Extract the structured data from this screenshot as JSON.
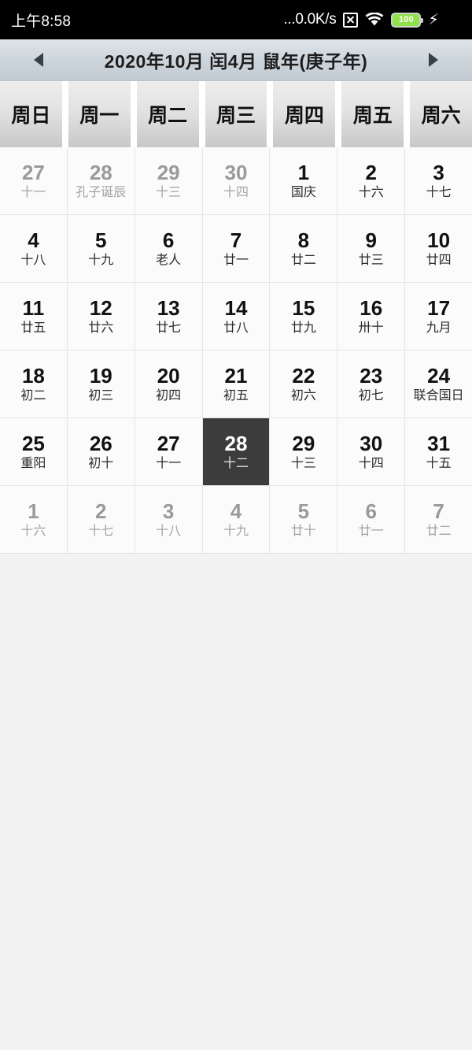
{
  "statusbar": {
    "time": "上午8:58",
    "net_speed": "...0.0K/s",
    "nosim_icon": "no-sim-icon",
    "wifi_icon": "wifi-icon",
    "battery_level": "100",
    "charging_icon": "⚡",
    "battery_color": "#8fe04a"
  },
  "titlebar": {
    "prev_label": "prev-month-arrow",
    "next_label": "next-month-arrow",
    "title": "2020年10月 闰4月 鼠年(庚子年)"
  },
  "weekdays": [
    "周日",
    "周一",
    "周二",
    "周三",
    "周四",
    "周五",
    "周六"
  ],
  "selected_day": "28",
  "weeks": [
    [
      {
        "num": "27",
        "sub": "十一",
        "month": "prev"
      },
      {
        "num": "28",
        "sub": "孔子诞辰",
        "month": "prev"
      },
      {
        "num": "29",
        "sub": "十三",
        "month": "prev"
      },
      {
        "num": "30",
        "sub": "十四",
        "month": "prev"
      },
      {
        "num": "1",
        "sub": "国庆",
        "month": "cur"
      },
      {
        "num": "2",
        "sub": "十六",
        "month": "cur"
      },
      {
        "num": "3",
        "sub": "十七",
        "month": "cur"
      }
    ],
    [
      {
        "num": "4",
        "sub": "十八",
        "month": "cur"
      },
      {
        "num": "5",
        "sub": "十九",
        "month": "cur"
      },
      {
        "num": "6",
        "sub": "老人",
        "month": "cur"
      },
      {
        "num": "7",
        "sub": "廿一",
        "month": "cur"
      },
      {
        "num": "8",
        "sub": "廿二",
        "month": "cur"
      },
      {
        "num": "9",
        "sub": "廿三",
        "month": "cur"
      },
      {
        "num": "10",
        "sub": "廿四",
        "month": "cur"
      }
    ],
    [
      {
        "num": "11",
        "sub": "廿五",
        "month": "cur"
      },
      {
        "num": "12",
        "sub": "廿六",
        "month": "cur"
      },
      {
        "num": "13",
        "sub": "廿七",
        "month": "cur"
      },
      {
        "num": "14",
        "sub": "廿八",
        "month": "cur"
      },
      {
        "num": "15",
        "sub": "廿九",
        "month": "cur"
      },
      {
        "num": "16",
        "sub": "卅十",
        "month": "cur"
      },
      {
        "num": "17",
        "sub": "九月",
        "month": "cur"
      }
    ],
    [
      {
        "num": "18",
        "sub": "初二",
        "month": "cur"
      },
      {
        "num": "19",
        "sub": "初三",
        "month": "cur"
      },
      {
        "num": "20",
        "sub": "初四",
        "month": "cur"
      },
      {
        "num": "21",
        "sub": "初五",
        "month": "cur"
      },
      {
        "num": "22",
        "sub": "初六",
        "month": "cur"
      },
      {
        "num": "23",
        "sub": "初七",
        "month": "cur"
      },
      {
        "num": "24",
        "sub": "联合国日",
        "month": "cur"
      }
    ],
    [
      {
        "num": "25",
        "sub": "重阳",
        "month": "cur"
      },
      {
        "num": "26",
        "sub": "初十",
        "month": "cur"
      },
      {
        "num": "27",
        "sub": "十一",
        "month": "cur"
      },
      {
        "num": "28",
        "sub": "十二",
        "month": "cur",
        "selected": true
      },
      {
        "num": "29",
        "sub": "十三",
        "month": "cur"
      },
      {
        "num": "30",
        "sub": "十四",
        "month": "cur"
      },
      {
        "num": "31",
        "sub": "十五",
        "month": "cur"
      }
    ],
    [
      {
        "num": "1",
        "sub": "十六",
        "month": "next"
      },
      {
        "num": "2",
        "sub": "十七",
        "month": "next"
      },
      {
        "num": "3",
        "sub": "十八",
        "month": "next"
      },
      {
        "num": "4",
        "sub": "十九",
        "month": "next"
      },
      {
        "num": "5",
        "sub": "廿十",
        "month": "next"
      },
      {
        "num": "6",
        "sub": "廿一",
        "month": "next"
      },
      {
        "num": "7",
        "sub": "廿二",
        "month": "next"
      }
    ]
  ]
}
